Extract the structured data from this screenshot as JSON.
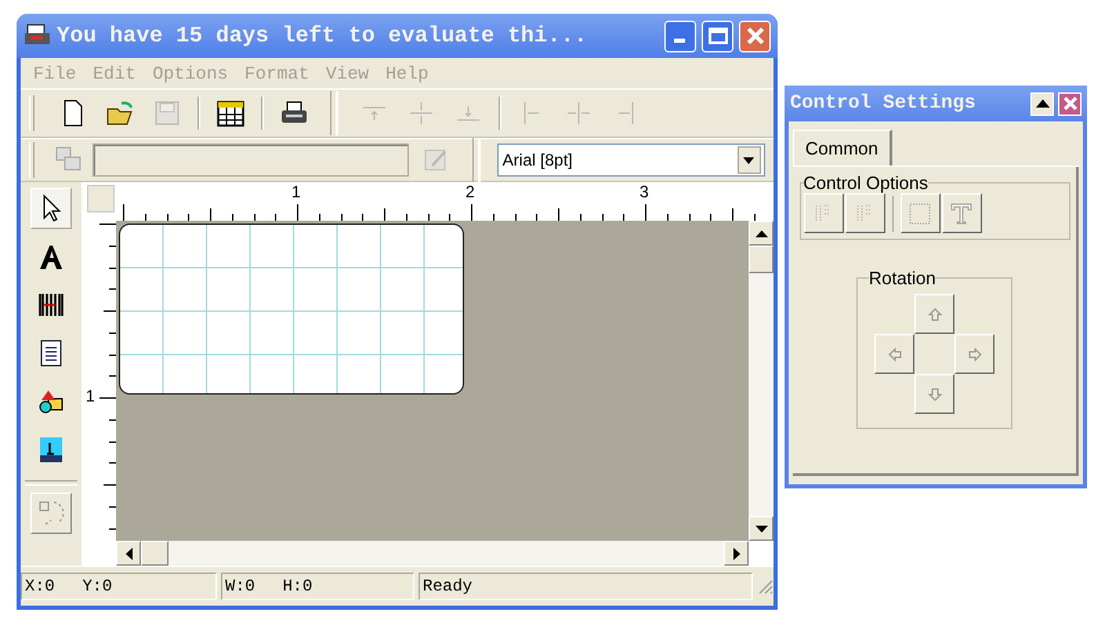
{
  "main_window": {
    "title": "You have 15 days left to evaluate thi..."
  },
  "menu": [
    {
      "label": "File",
      "disabled": true
    },
    {
      "label": "Edit",
      "disabled": true
    },
    {
      "label": "Options",
      "disabled": true
    },
    {
      "label": "Format",
      "disabled": true
    },
    {
      "label": "View",
      "disabled": true
    },
    {
      "label": "Help",
      "disabled": true
    }
  ],
  "toolbar": [
    {
      "kind": "new",
      "disabled": false
    },
    {
      "kind": "open",
      "disabled": false
    },
    {
      "kind": "save",
      "disabled": true
    },
    {
      "kind": "sep"
    },
    {
      "kind": "grid",
      "disabled": false
    },
    {
      "kind": "sep"
    },
    {
      "kind": "print",
      "disabled": false
    },
    {
      "kind": "bar"
    },
    {
      "kind": "align-top",
      "disabled": true
    },
    {
      "kind": "align-middle",
      "disabled": true
    },
    {
      "kind": "align-bottom",
      "disabled": true
    },
    {
      "kind": "sep"
    },
    {
      "kind": "align-left",
      "disabled": true
    },
    {
      "kind": "align-center",
      "disabled": true
    },
    {
      "kind": "align-right",
      "disabled": true
    }
  ],
  "font_select": {
    "value": "Arial [8pt]"
  },
  "tools": [
    {
      "kind": "pointer",
      "selected": true
    },
    {
      "kind": "text",
      "selected": false
    },
    {
      "kind": "barcode",
      "selected": false
    },
    {
      "kind": "document",
      "selected": false
    },
    {
      "kind": "shapes",
      "selected": false
    },
    {
      "kind": "image",
      "selected": false
    }
  ],
  "ruler": {
    "top_labels": [
      "1",
      "2",
      "3"
    ],
    "left_labels": [
      "1"
    ]
  },
  "status_bar": [
    {
      "label": "X:0"
    },
    {
      "label": "Y:0"
    },
    {
      "label": "W:0"
    },
    {
      "label": "H:0"
    },
    {
      "label": "Ready"
    }
  ],
  "control_settings": {
    "title": "Control Settings",
    "tabs": [
      {
        "label": "Common",
        "selected": true
      }
    ],
    "control_options": {
      "title": "Control Options",
      "buttons": [
        {
          "kind": "align-left",
          "disabled": true
        },
        {
          "kind": "align-right",
          "disabled": true
        },
        {
          "kind": "border",
          "disabled": true
        },
        {
          "kind": "text-style",
          "disabled": true
        }
      ]
    },
    "rotation": {
      "title": "Rotation"
    }
  }
}
